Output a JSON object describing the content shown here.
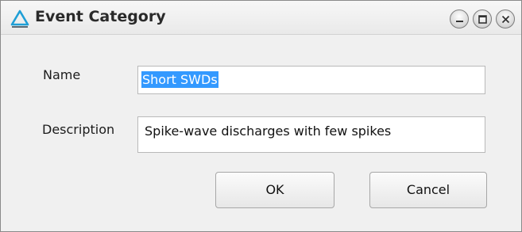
{
  "window": {
    "title": "Event Category",
    "icon": "delta-app-icon",
    "controls": [
      "minimize-icon",
      "maximize-icon",
      "close-icon"
    ]
  },
  "form": {
    "name_label": "Name",
    "name_value": "Short SWDs",
    "description_label": "Description",
    "description_value": "Spike-wave discharges with few spikes"
  },
  "buttons": {
    "ok_label": "OK",
    "cancel_label": "Cancel"
  },
  "colors": {
    "accent": "#1f9fd6",
    "selection": "#3399ff"
  }
}
